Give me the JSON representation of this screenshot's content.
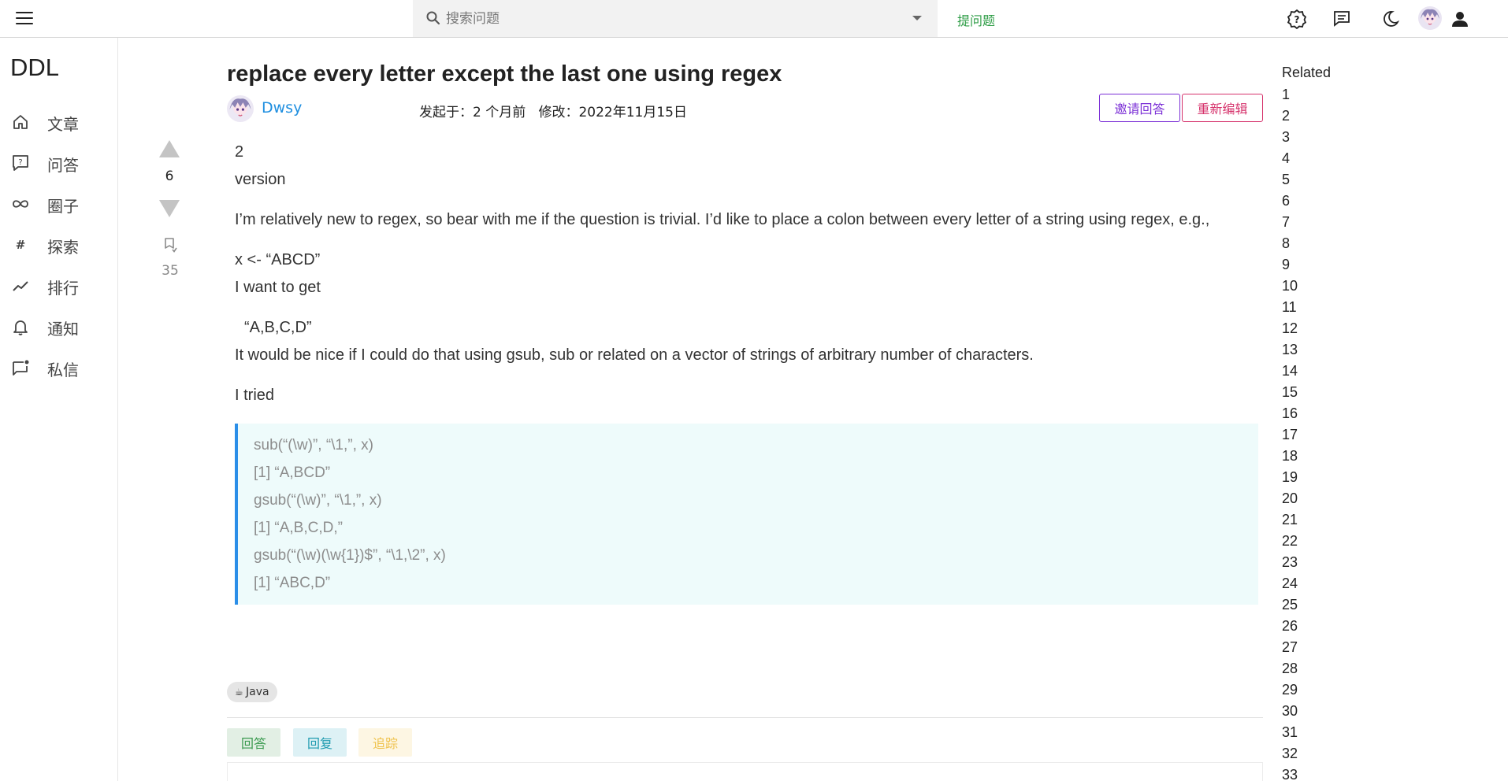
{
  "topbar": {
    "search_placeholder": "搜索问题",
    "ask_label": "提问题",
    "icons": [
      "menu-icon",
      "search-icon",
      "help-icon",
      "messages-icon",
      "dark-mode-icon",
      "user-avatar",
      "account-icon"
    ]
  },
  "sidebar": {
    "brand": "DDL",
    "items": [
      {
        "label": "文章",
        "icon": "home-icon"
      },
      {
        "label": "问答",
        "icon": "question-icon"
      },
      {
        "label": "圈子",
        "icon": "infinity-icon"
      },
      {
        "label": "探索",
        "icon": "hash-icon"
      },
      {
        "label": "排行",
        "icon": "trending-icon"
      },
      {
        "label": "通知",
        "icon": "bell-icon"
      },
      {
        "label": "私信",
        "icon": "chat-icon"
      }
    ]
  },
  "question": {
    "title": "replace every letter except the last one using regex",
    "author": "Dwsy",
    "started_label": "发起于：2 个月前",
    "modified_label": "修改：2022年11月15日",
    "invite_label": "邀请回答",
    "reedit_label": "重新编辑",
    "vote_count": "6",
    "favorite_count": "35",
    "body": {
      "line1": "2",
      "line2": "version",
      "para1": "I’m relatively new to regex, so bear with me if the question is trivial. I’d like to place a colon between every letter of a string using regex, e.g.,",
      "x_line": "x <- “ABCD”",
      "want_line": "I want to get",
      "abcd_line": "“A,B,C,D”",
      "nice_line": "It would be nice if I could do that using gsub, sub or related on a vector of strings of arbitrary number of characters.",
      "tried_line": "I tried"
    },
    "code_lines": [
      "sub(“(\\w)”, “\\1,”, x)",
      "[1] “A,BCD”",
      "gsub(“(\\w)”, “\\1,”, x)",
      "[1] “A,B,C,D,”",
      "gsub(“(\\w)(\\w{1})$”, “\\1,\\2”, x)",
      "[1] “ABC,D”"
    ],
    "tag": "Java",
    "actions": {
      "answer": "回答",
      "reply": "回复",
      "track": "追踪"
    }
  },
  "related": {
    "title": "Related",
    "items": [
      "1",
      "2",
      "3",
      "4",
      "5",
      "6",
      "7",
      "8",
      "9",
      "10",
      "11",
      "12",
      "13",
      "14",
      "15",
      "16",
      "17",
      "18",
      "19",
      "20",
      "21",
      "22",
      "23",
      "24",
      "25",
      "26",
      "27",
      "28",
      "29",
      "30",
      "31",
      "32",
      "33"
    ]
  },
  "colors": {
    "accent_green": "#2e9d46",
    "author_blue": "#1f8fe0",
    "invite_purple": "#7b2fd6",
    "reedit_pink": "#d6336c",
    "code_border": "#2b8ee8",
    "code_bg": "#eefbfb"
  }
}
